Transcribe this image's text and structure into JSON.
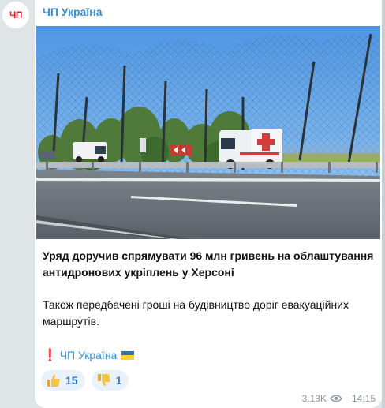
{
  "channel": {
    "avatar_text": "ЧП",
    "name": "ЧП Україна"
  },
  "post": {
    "headline": "Уряд доручив спрямувати 96 млн гривень на облаштування антидронових укріплень у Херсоні",
    "body": "Також передбачені гроші на будівництво доріг евакуаційних маршрутів.",
    "signature_mark": "❗",
    "signature_link": "ЧП Україна",
    "signature_flag": "ukraine-flag-icon"
  },
  "reactions": [
    {
      "emoji": "thumbs-up-icon",
      "count": "15"
    },
    {
      "emoji": "thumbs-down-icon",
      "count": "1"
    }
  ],
  "meta": {
    "views": "3.13K",
    "views_icon": "eye-icon",
    "time": "14:15"
  },
  "colors": {
    "link": "#3a8dcf",
    "reaction_bg": "#e9f2fb",
    "reaction_text": "#2f79c2",
    "background": "#dfe4e6"
  }
}
